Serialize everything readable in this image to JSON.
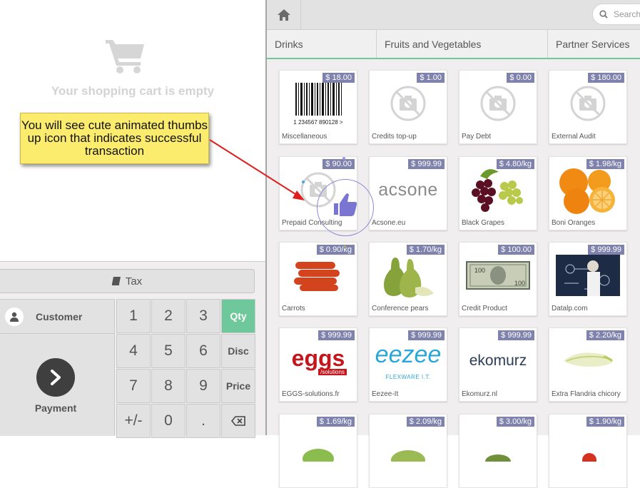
{
  "cart": {
    "empty_text": "Your shopping cart is empty"
  },
  "callout": {
    "text": "You will see cute animated thumbs up icon that indicates successful transaction"
  },
  "tax_label": "Tax",
  "customer_label": "Customer",
  "payment_label": "Payment",
  "numpad": {
    "keys": [
      "1",
      "2",
      "3",
      "4",
      "5",
      "6",
      "7",
      "8",
      "9",
      "+/-",
      "0",
      "."
    ],
    "modes": [
      "Qty",
      "Disc",
      "Price"
    ],
    "selected_mode": "Qty"
  },
  "search": {
    "placeholder": "Search"
  },
  "categories": [
    "Drinks",
    "Fruits and Vegetables",
    "Partner Services"
  ],
  "products": [
    {
      "name": "Miscellaneous",
      "price": "$ 18.00"
    },
    {
      "name": "Credits top-up",
      "price": "$ 1.00"
    },
    {
      "name": "Pay Debt",
      "price": "$ 0.00"
    },
    {
      "name": "External Audit",
      "price": "$ 180.00"
    },
    {
      "name": "Prepaid Consulting",
      "price": "$ 90.00"
    },
    {
      "name": "Acsone.eu",
      "price": "$ 999.99"
    },
    {
      "name": "Black Grapes",
      "price": "$ 4.80/kg"
    },
    {
      "name": "Boni Oranges",
      "price": "$ 1.98/kg"
    },
    {
      "name": "Carrots",
      "price": "$ 0.90/kg"
    },
    {
      "name": "Conference pears",
      "price": "$ 1.70/kg"
    },
    {
      "name": "Credit Product",
      "price": "$ 100.00"
    },
    {
      "name": "Datalp.com",
      "price": "$ 999.99"
    },
    {
      "name": "EGGS-solutions.fr",
      "price": "$ 999.99"
    },
    {
      "name": "Eezee-It",
      "price": "$ 999.99"
    },
    {
      "name": "Ekomurz.nl",
      "price": "$ 999.99"
    },
    {
      "name": "Extra Flandria chicory",
      "price": "$ 2.20/kg"
    },
    {
      "name": "",
      "price": "$ 1.69/kg"
    },
    {
      "name": "",
      "price": "$ 2.09/kg"
    },
    {
      "name": "",
      "price": "$ 3.00/kg"
    },
    {
      "name": "",
      "price": "$ 1.90/kg"
    }
  ],
  "logos": {
    "barcode_digits": "1 234567 890128 >",
    "acsone": "acsone",
    "eggs": "eggs",
    "eggs_sub": "/solutions",
    "eezee": "eezee",
    "eezee_sub": "FLEXWARE I.T.",
    "ekomurz": "ekomurz"
  },
  "colors": {
    "accent": "#6ec89b",
    "price_badge": "#7f82ac",
    "thumbs": "#8c88d6",
    "callout": "#fbec6e"
  }
}
